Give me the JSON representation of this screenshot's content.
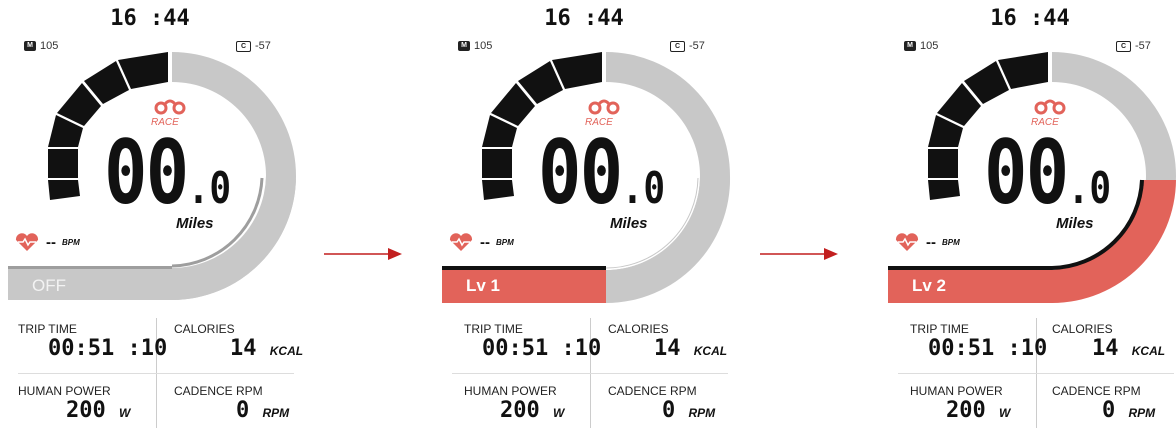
{
  "colors": {
    "accent": "#e2635a",
    "dark": "#111111",
    "ring_grey": "#c8c8c8",
    "off_grey": "#c4c4c4"
  },
  "screens": [
    {
      "time": "16 :44",
      "odometer": "105",
      "temp": "-57",
      "distance_int": "00",
      "distance_dec": ".0",
      "distance_unit": "Miles",
      "brand": "RACE",
      "heart_rate": "--",
      "heart_unit": "BPM",
      "level": "OFF",
      "trip_time_label": "TRIP TIME",
      "trip_time": "00:51 :10",
      "calories_label": "CALORIES",
      "calories": "14",
      "calories_unit": "KCAL",
      "power_label": "HUMAN POWER",
      "power": "200",
      "power_unit": "W",
      "cadence_label": "CADENCE RPM",
      "cadence": "0",
      "cadence_unit": "RPM",
      "speed_segments_filled": 4,
      "assist_level_fill": 0
    },
    {
      "time": "16 :44",
      "odometer": "105",
      "temp": "-57",
      "distance_int": "00",
      "distance_dec": ".0",
      "distance_unit": "Miles",
      "brand": "RACE",
      "heart_rate": "--",
      "heart_unit": "BPM",
      "level": "Lv 1",
      "trip_time_label": "TRIP TIME",
      "trip_time": "00:51 :10",
      "calories_label": "CALORIES",
      "calories": "14",
      "calories_unit": "KCAL",
      "power_label": "HUMAN POWER",
      "power": "200",
      "power_unit": "W",
      "cadence_label": "CADENCE RPM",
      "cadence": "0",
      "cadence_unit": "RPM",
      "speed_segments_filled": 4,
      "assist_level_fill": 1
    },
    {
      "time": "16 :44",
      "odometer": "105",
      "temp": "-57",
      "distance_int": "00",
      "distance_dec": ".0",
      "distance_unit": "Miles",
      "brand": "RACE",
      "heart_rate": "--",
      "heart_unit": "BPM",
      "level": "Lv 2",
      "trip_time_label": "TRIP TIME",
      "trip_time": "00:51 :10",
      "calories_label": "CALORIES",
      "calories": "14",
      "calories_unit": "KCAL",
      "power_label": "HUMAN POWER",
      "power": "200",
      "power_unit": "W",
      "cadence_label": "CADENCE RPM",
      "cadence": "0",
      "cadence_unit": "RPM",
      "speed_segments_filled": 4,
      "assist_level_fill": 2
    }
  ]
}
